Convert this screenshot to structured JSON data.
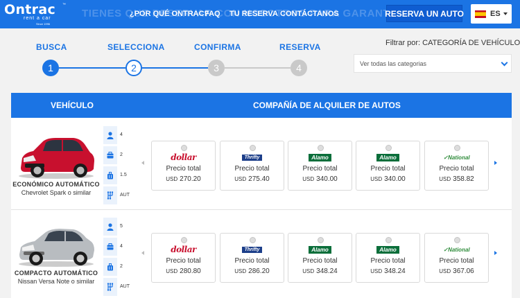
{
  "header": {
    "logo_main": "Ontrac",
    "logo_sub": "rent a car",
    "logo_tag": "Since 1996",
    "ghost_text": "TIENES QUE RESERVAR CON NOSOTROS PARA GARANTIZAR T",
    "nav": [
      "¿POR QUÉ ONTRAC?",
      "FAQ",
      "TU RESERVA",
      "CONTÁCTANOS"
    ],
    "reserve_button": "RESERVA UN AUTO",
    "language": "ES"
  },
  "steps": [
    {
      "label": "BUSCA",
      "number": "1",
      "state": "active"
    },
    {
      "label": "SELECCIONA",
      "number": "2",
      "state": "current"
    },
    {
      "label": "CONFIRMA",
      "number": "3",
      "state": "inactive"
    },
    {
      "label": "RESERVA",
      "number": "4",
      "state": "inactive"
    }
  ],
  "filter": {
    "label": "Filtrar por: CATEGORÍA DE VEHÍCULOS",
    "selected": "Ver todas las categorias"
  },
  "table": {
    "header_vehicle": "VEHÍCULO",
    "header_company": "COMPAÑÍA DE ALQUILER DE AUTOS",
    "price_label": "Precio total",
    "currency": "USD"
  },
  "companies": [
    {
      "name": "dollar",
      "logo": "dollar"
    },
    {
      "name": "Thrifty",
      "logo": "thrifty"
    },
    {
      "name": "Alamo",
      "logo": "alamo"
    },
    {
      "name": "Alamo",
      "logo": "alamo"
    },
    {
      "name": "National",
      "logo": "national"
    }
  ],
  "vehicles": [
    {
      "category": "ECONÓMICO AUTOMÁTICO",
      "model": "Chevrolet Spark o similar",
      "color": "#c8102e",
      "features": [
        {
          "icon": "person-icon",
          "value": "4"
        },
        {
          "icon": "small-bag-icon",
          "value": "2"
        },
        {
          "icon": "suitcase-icon",
          "value": "1.5"
        },
        {
          "icon": "gearshift-icon",
          "value": "AUT"
        }
      ],
      "prices": [
        "270.20",
        "275.40",
        "340.00",
        "340.00",
        "358.82"
      ]
    },
    {
      "category": "COMPACTO AUTOMÁTICO",
      "model": "Nissan Versa Note o similar",
      "color": "#b8bcc0",
      "features": [
        {
          "icon": "person-icon",
          "value": "5"
        },
        {
          "icon": "small-bag-icon",
          "value": "4"
        },
        {
          "icon": "suitcase-icon",
          "value": "2"
        },
        {
          "icon": "gearshift-icon",
          "value": "AUT"
        }
      ],
      "prices": [
        "280.80",
        "286.20",
        "348.24",
        "348.24",
        "367.06"
      ]
    }
  ],
  "colors": {
    "brand": "#1b74e4",
    "inactive": "#c9c9c9"
  }
}
